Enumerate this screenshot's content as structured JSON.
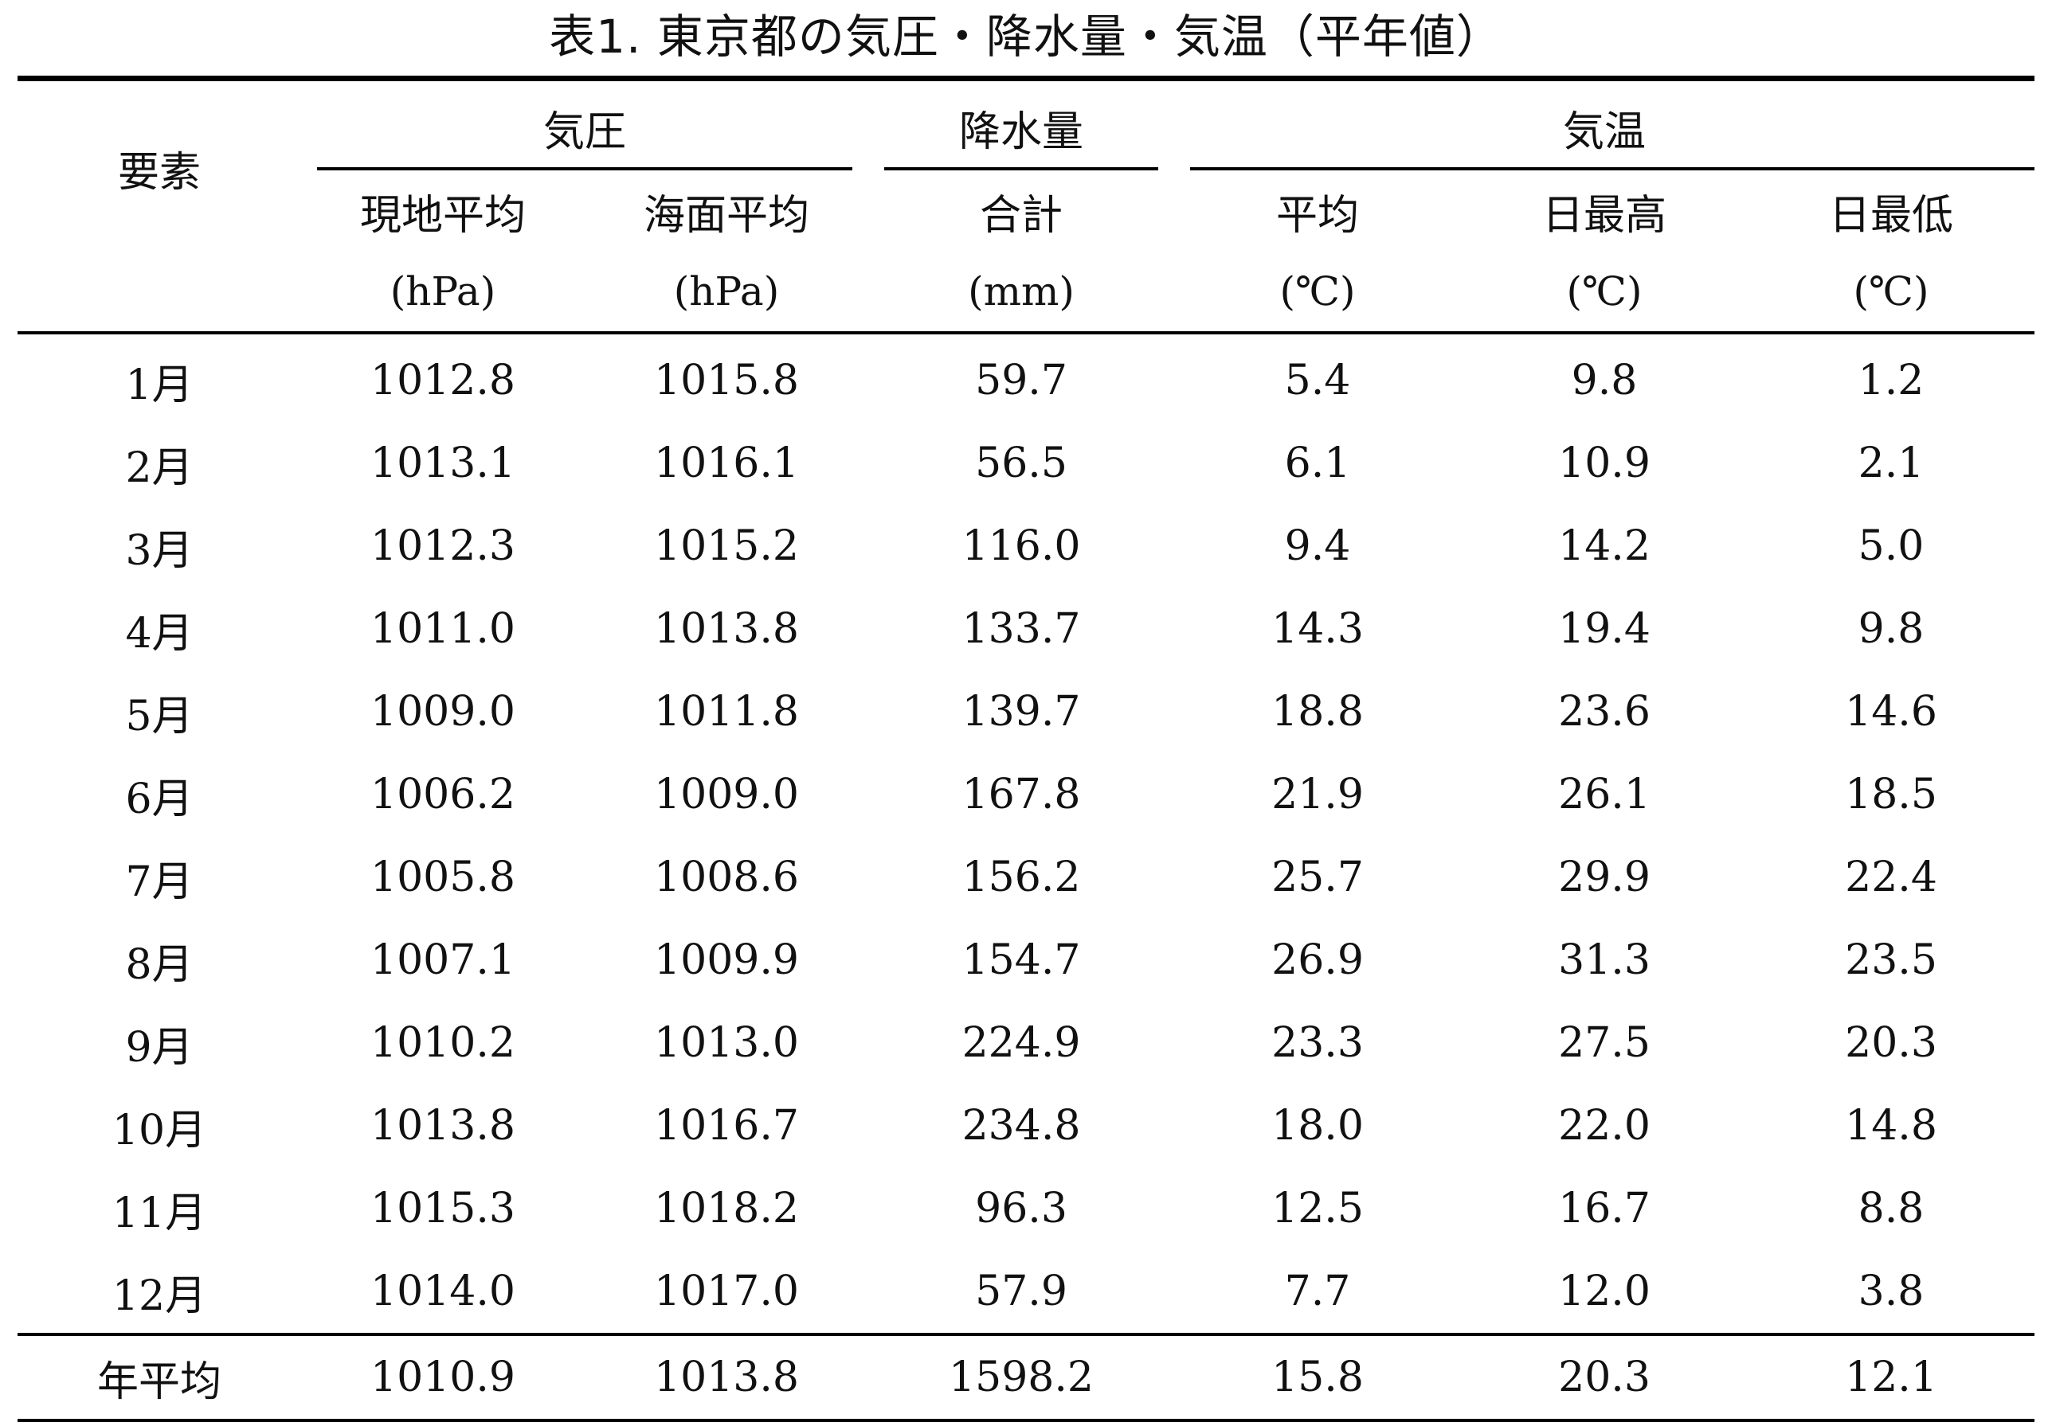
{
  "caption": "表1. 東京都の気圧・降水量・気温（平年値）",
  "header": {
    "element_label": "要素",
    "groups": {
      "pressure": "気圧",
      "precipitation": "降水量",
      "temperature": "気温"
    },
    "columns": [
      "現地平均",
      "海面平均",
      "合計",
      "平均",
      "日最高",
      "日最低"
    ],
    "units": [
      "(hPa)",
      "(hPa)",
      "(mm)",
      "(℃)",
      "(℃)",
      "(℃)"
    ]
  },
  "rows": [
    {
      "label": "1月",
      "values": [
        "1012.8",
        "1015.8",
        "59.7",
        "5.4",
        "9.8",
        "1.2"
      ]
    },
    {
      "label": "2月",
      "values": [
        "1013.1",
        "1016.1",
        "56.5",
        "6.1",
        "10.9",
        "2.1"
      ]
    },
    {
      "label": "3月",
      "values": [
        "1012.3",
        "1015.2",
        "116.0",
        "9.4",
        "14.2",
        "5.0"
      ]
    },
    {
      "label": "4月",
      "values": [
        "1011.0",
        "1013.8",
        "133.7",
        "14.3",
        "19.4",
        "9.8"
      ]
    },
    {
      "label": "5月",
      "values": [
        "1009.0",
        "1011.8",
        "139.7",
        "18.8",
        "23.6",
        "14.6"
      ]
    },
    {
      "label": "6月",
      "values": [
        "1006.2",
        "1009.0",
        "167.8",
        "21.9",
        "26.1",
        "18.5"
      ]
    },
    {
      "label": "7月",
      "values": [
        "1005.8",
        "1008.6",
        "156.2",
        "25.7",
        "29.9",
        "22.4"
      ]
    },
    {
      "label": "8月",
      "values": [
        "1007.1",
        "1009.9",
        "154.7",
        "26.9",
        "31.3",
        "23.5"
      ]
    },
    {
      "label": "9月",
      "values": [
        "1010.2",
        "1013.0",
        "224.9",
        "23.3",
        "27.5",
        "20.3"
      ]
    },
    {
      "label": "10月",
      "values": [
        "1013.8",
        "1016.7",
        "234.8",
        "18.0",
        "22.0",
        "14.8"
      ]
    },
    {
      "label": "11月",
      "values": [
        "1015.3",
        "1018.2",
        "96.3",
        "12.5",
        "16.7",
        "8.8"
      ]
    },
    {
      "label": "12月",
      "values": [
        "1014.0",
        "1017.0",
        "57.9",
        "7.7",
        "12.0",
        "3.8"
      ]
    }
  ],
  "annual": {
    "label": "年平均",
    "values": [
      "1010.9",
      "1013.8",
      "1598.2",
      "15.8",
      "20.3",
      "12.1"
    ]
  }
}
